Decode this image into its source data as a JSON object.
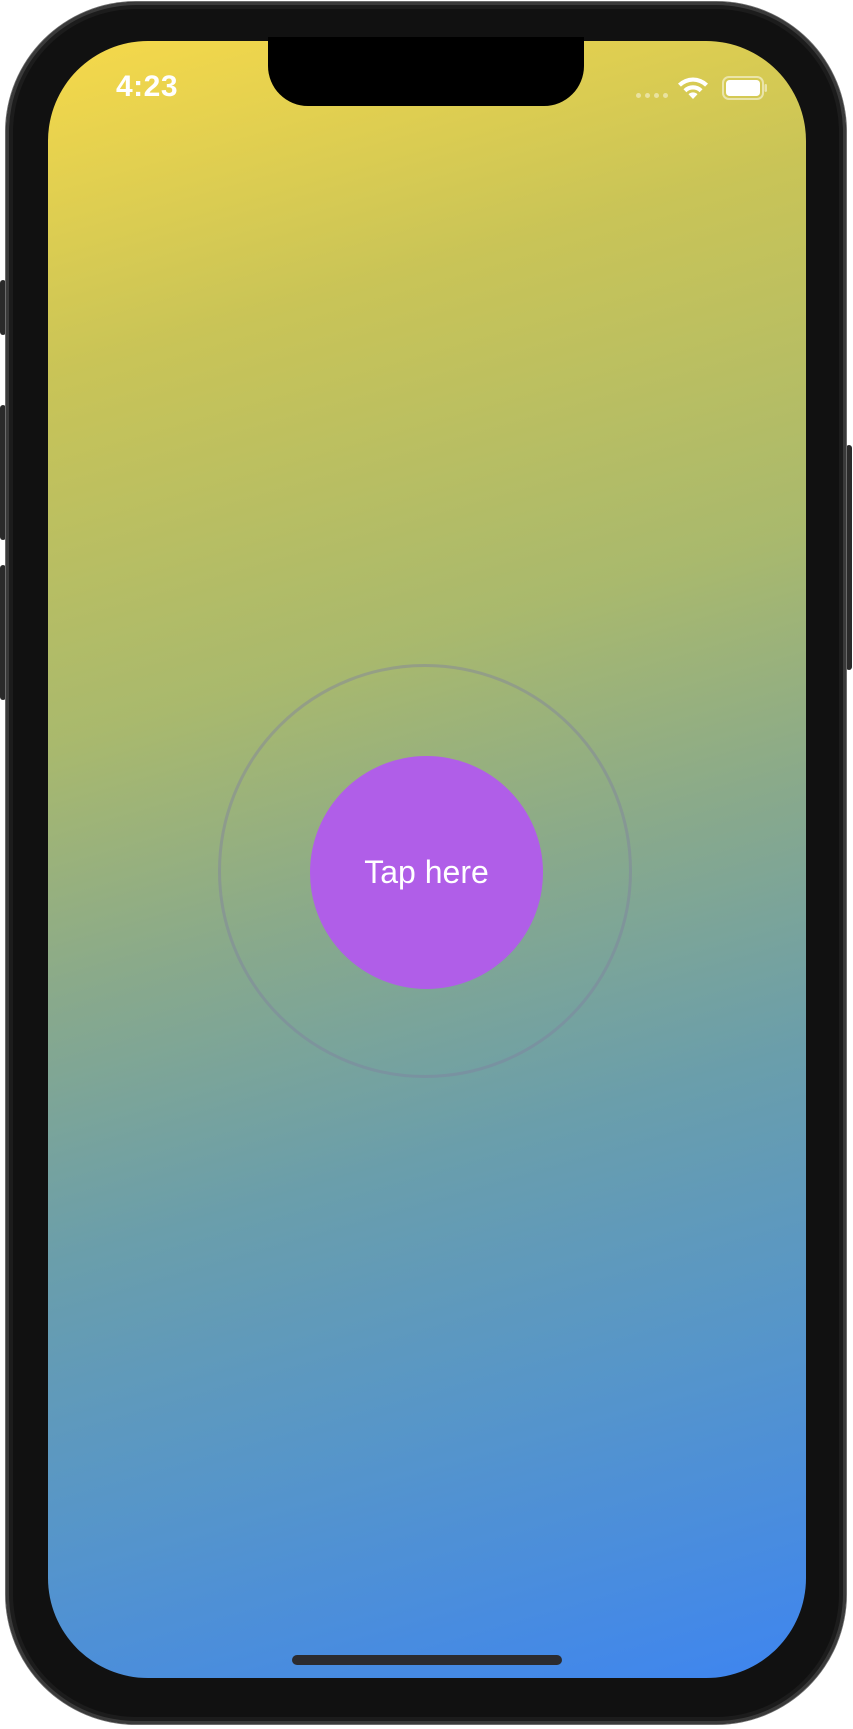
{
  "status_bar": {
    "time": "4:23",
    "wifi_icon": "wifi-icon",
    "battery_icon": "battery-icon",
    "battery_level": 1.0
  },
  "background": {
    "gradient_colors": [
      "#f6d94a",
      "#a9b96d",
      "#6a9eab",
      "#3e85f0"
    ]
  },
  "main": {
    "tap_button_label": "Tap here",
    "tap_button_color": "#b05ee8"
  }
}
